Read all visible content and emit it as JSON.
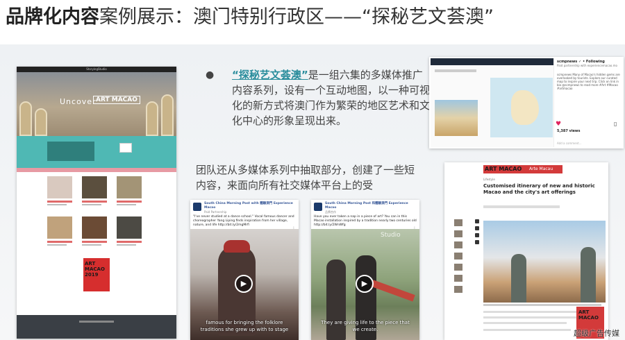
{
  "title": {
    "bold_part": "品牌化内容",
    "light_part": "案例展示：澳门特别行政区——“探秘艺文荟澳”"
  },
  "bullet": {
    "symbol": "●",
    "highlight": "“探秘艺文荟澳”",
    "text": "是一组六集的多媒体推广内容系列，设有一个互动地图，以一种可视化的新方式将澳门作为繁荣的地区艺术和文化中心的形象呈现出来。"
  },
  "paragraph2": "团队还从多媒体系列中抽取部分，创建了一些短内容，来面向所有社交媒体平台上的受",
  "website": {
    "nav_label": "StoryingStudio",
    "hero_text": "Uncover",
    "hero_logo": "ART MACAO"
  },
  "instagram": {
    "username": "scmpnews ✓ • Following",
    "meta": "Paid partnership with experiencemacao.mo",
    "description": "scmpnews Many of Macao's hidden gems are overlooked by tourists. Explore our curated map to inspire your next trip. Click on link in bio @scmpnews to read more #Art #Macao #artmacao",
    "views": "5,387 views",
    "comment_placeholder": "Add a comment..."
  },
  "article": {
    "banner": "ART MACAO",
    "banner_sub": "Arte Macau",
    "section": "Lifestyle",
    "headline": "Customised itinerary of new and historic Macao and the city's art offerings"
  },
  "fb1": {
    "page": "South China Morning Post with 體驗澳門 Experience Macao",
    "sub": "Paid Partnership",
    "text": "\"I've never studied at a dance school.\" Vocal famous dancer and choreographer Yang Liping finds inspiration from her village, nature, and life http://bit.ly/2mgMrfi",
    "subtitle": "famous for bringing the folklore traditions she grew up with to stage"
  },
  "fb2": {
    "page": "South China Morning Post 和體驗澳門 Experience Macao",
    "sub": "品牌合作",
    "text": "Have you ever taken a nap in a piece of art? You can in this Macao installation inspired by a tradition nearly two centuries old http://bit.ly/2WnWfg",
    "subtitle": "They are giving life to the piece that we create.",
    "studio_label": "Studio"
  },
  "poster": {
    "line1": "ART",
    "line2": "MACAO",
    "line3": "2019"
  },
  "watermark": "超级广告传媒"
}
